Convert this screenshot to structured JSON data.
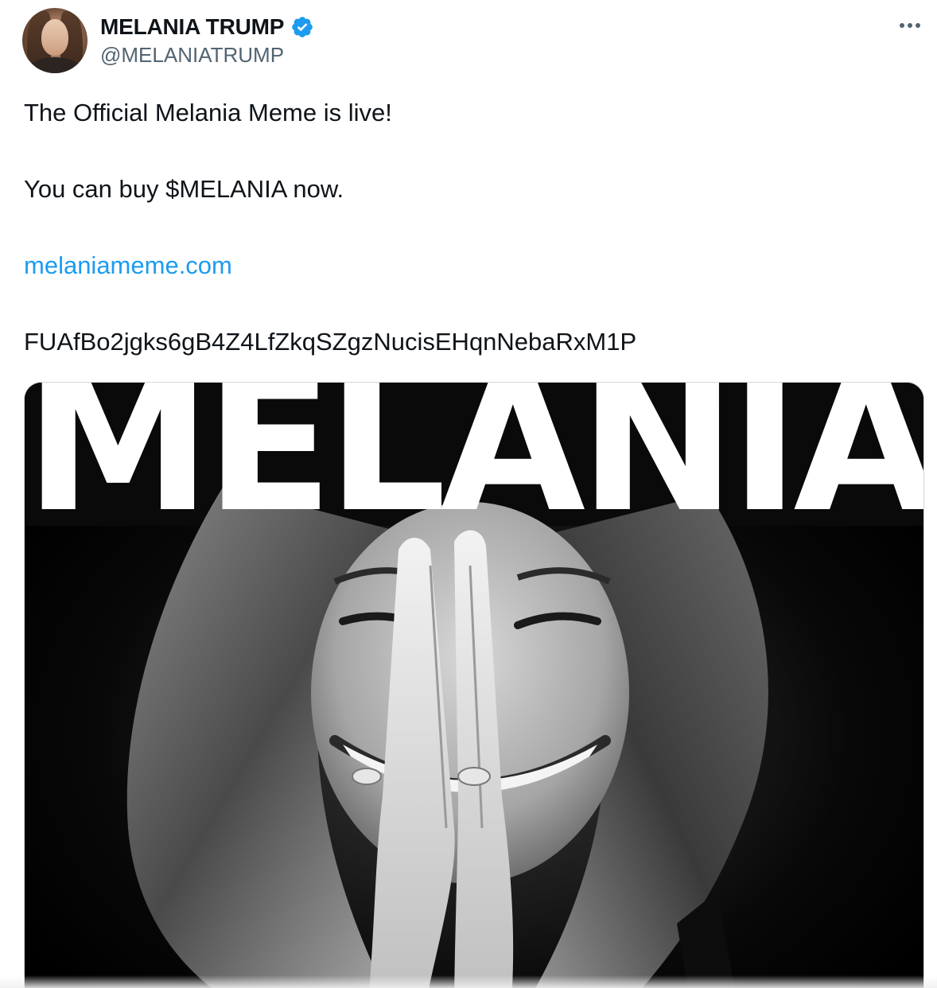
{
  "author": {
    "display_name": "MELANIA TRUMP",
    "handle": "@MELANIATRUMP",
    "verified": true,
    "avatar_icon": "profile-photo",
    "verified_color": "#1d9bf0"
  },
  "actions": {
    "more_icon": "more-horizontal-icon"
  },
  "tweet": {
    "line_1": "The Official Melania Meme is live!",
    "line_2": "You can buy $MELANIA now.",
    "link": "melaniameme.com",
    "line_4": "FUAfBo2jgks6gB4Z4LfZkqSZgzNucisEHqnNebaRxM1P",
    "link_color": "#1d9bf0"
  },
  "media": {
    "title_text": "MELANIA",
    "description_icon": "black-and-white-portrait-photo"
  }
}
